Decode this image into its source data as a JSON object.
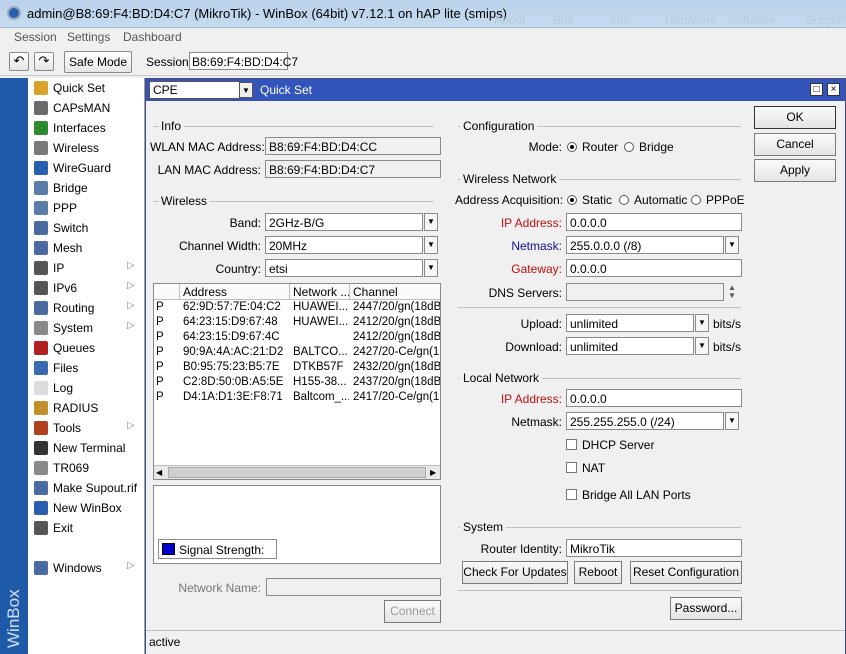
{
  "title": "admin@B8:69:F4:BD:D4:C7 (MikroTik) - WinBox (64bit) v7.12.1 on hAP lite (smips)",
  "title_bg_items": [
    "About",
    "Bus",
    "Info",
    "Hardware",
    "Software",
    "Support"
  ],
  "menu": [
    "Session",
    "Settings",
    "Dashboard"
  ],
  "toolbar": {
    "undo": "↶",
    "redo": "↷",
    "safe_mode": "Safe Mode",
    "session_label": "Session:",
    "session_value": "B8:69:F4:BD:D4:C7"
  },
  "brand": "WinBox",
  "sidebar": [
    {
      "label": "Quick Set",
      "icon": "quickset-icon",
      "color": "#d9a32a",
      "arrow": ""
    },
    {
      "label": "CAPsMAN",
      "icon": "capsman-icon",
      "color": "#6a6a6a",
      "arrow": ""
    },
    {
      "label": "Interfaces",
      "icon": "interfaces-icon",
      "color": "#2f8a2f",
      "arrow": ""
    },
    {
      "label": "Wireless",
      "icon": "wireless-icon",
      "color": "#7a7a7a",
      "arrow": ""
    },
    {
      "label": "WireGuard",
      "icon": "wireguard-icon",
      "color": "#2a5fb0",
      "arrow": ""
    },
    {
      "label": "Bridge",
      "icon": "bridge-icon",
      "color": "#5a7da8",
      "arrow": ""
    },
    {
      "label": "PPP",
      "icon": "ppp-icon",
      "color": "#5a7da8",
      "arrow": ""
    },
    {
      "label": "Switch",
      "icon": "switch-icon",
      "color": "#4a6aa0",
      "arrow": ""
    },
    {
      "label": "Mesh",
      "icon": "mesh-icon",
      "color": "#4a6aa0",
      "arrow": ""
    },
    {
      "label": "IP",
      "icon": "ip-icon",
      "color": "#555555",
      "arrow": "▷"
    },
    {
      "label": "IPv6",
      "icon": "ipv6-icon",
      "color": "#555555",
      "arrow": "▷"
    },
    {
      "label": "Routing",
      "icon": "routing-icon",
      "color": "#4a6aa0",
      "arrow": "▷"
    },
    {
      "label": "System",
      "icon": "system-icon",
      "color": "#8a8a8a",
      "arrow": "▷"
    },
    {
      "label": "Queues",
      "icon": "queues-icon",
      "color": "#b02020",
      "arrow": ""
    },
    {
      "label": "Files",
      "icon": "files-icon",
      "color": "#3a6ab0",
      "arrow": ""
    },
    {
      "label": "Log",
      "icon": "log-icon",
      "color": "#dcdcdc",
      "arrow": ""
    },
    {
      "label": "RADIUS",
      "icon": "radius-icon",
      "color": "#c0902a",
      "arrow": ""
    },
    {
      "label": "Tools",
      "icon": "tools-icon",
      "color": "#b04020",
      "arrow": "▷"
    },
    {
      "label": "New Terminal",
      "icon": "terminal-icon",
      "color": "#333333",
      "arrow": ""
    },
    {
      "label": "TR069",
      "icon": "tr069-icon",
      "color": "#8a8a8a",
      "arrow": ""
    },
    {
      "label": "Make Supout.rif",
      "icon": "supout-icon",
      "color": "#4a6aa0",
      "arrow": ""
    },
    {
      "label": "New WinBox",
      "icon": "winbox-icon",
      "color": "#2a5fb0",
      "arrow": ""
    },
    {
      "label": "Exit",
      "icon": "exit-icon",
      "color": "#555555",
      "arrow": ""
    }
  ],
  "windows_item": {
    "label": "Windows",
    "icon": "windows-icon",
    "color": "#4a6aa0",
    "arrow": "▷"
  },
  "win": {
    "mode_select": "CPE",
    "title": "Quick Set"
  },
  "info": {
    "title": "Info",
    "wlan_mac_label": "WLAN MAC Address:",
    "wlan_mac": "B8:69:F4:BD:D4:CC",
    "lan_mac_label": "LAN MAC Address:",
    "lan_mac": "B8:69:F4:BD:D4:C7"
  },
  "wireless": {
    "title": "Wireless",
    "band_label": "Band:",
    "band": "2GHz-B/G",
    "width_label": "Channel Width:",
    "width": "20MHz",
    "country_label": "Country:",
    "country": "etsi"
  },
  "scan_table": {
    "headers": [
      "Address",
      "Network ...",
      "Channel"
    ],
    "rows": [
      [
        "P",
        "62:9D:57:7E:04:C2",
        "HUAWEI...",
        "2447/20/gn(18dB..."
      ],
      [
        "P",
        "64:23:15:D9:67:48",
        "HUAWEI...",
        "2412/20/gn(18dB..."
      ],
      [
        "P",
        "64:23:15:D9:67:4C",
        "",
        "2412/20/gn(18dB..."
      ],
      [
        "P",
        "90:9A:4A:AC:21:D2",
        "BALTCO...",
        "2427/20-Ce/gn(1..."
      ],
      [
        "P",
        "B0:95:75:23:B5:7E",
        "DTKB57F",
        "2432/20/gn(18dB..."
      ],
      [
        "P",
        "C2:8D:50:0B:A5:5E",
        "H155-38...",
        "2437/20/gn(18dB..."
      ],
      [
        "P",
        "D4:1A:D1:3E:F8:71",
        "Baltcom_...",
        "2417/20-Ce/gn(1..."
      ]
    ]
  },
  "signal_legend": "Signal Strength:",
  "network_name_label": "Network Name:",
  "network_name": "",
  "connect": "Connect",
  "status": "active",
  "config": {
    "title": "Configuration",
    "mode_label": "Mode:",
    "router": "Router",
    "bridge": "Bridge"
  },
  "wnet": {
    "title": "Wireless Network",
    "acq_label": "Address Acquisition:",
    "static": "Static",
    "automatic": "Automatic",
    "pppoe": "PPPoE",
    "ip_label": "IP Address:",
    "ip": "0.0.0.0",
    "mask_label": "Netmask:",
    "mask": "255.0.0.0 (/8)",
    "gw_label": "Gateway:",
    "gw": "0.0.0.0",
    "dns_label": "DNS Servers:",
    "dns": "",
    "upload_label": "Upload:",
    "upload": "unlimited",
    "download_label": "Download:",
    "download": "unlimited",
    "unit": "bits/s"
  },
  "lnet": {
    "title": "Local Network",
    "ip_label": "IP Address:",
    "ip": "0.0.0.0",
    "mask_label": "Netmask:",
    "mask": "255.255.255.0 (/24)",
    "dhcp": "DHCP Server",
    "nat": "NAT",
    "bridge_all": "Bridge All LAN Ports"
  },
  "system": {
    "title": "System",
    "identity_label": "Router Identity:",
    "identity": "MikroTik",
    "check": "Check For Updates",
    "reboot": "Reboot",
    "reset": "Reset Configuration",
    "password": "Password..."
  },
  "buttons": {
    "ok": "OK",
    "cancel": "Cancel",
    "apply": "Apply"
  },
  "colors": {
    "title_bar": "#3355bb",
    "brand": "#1e5aa8",
    "signal": "#0000cc"
  }
}
